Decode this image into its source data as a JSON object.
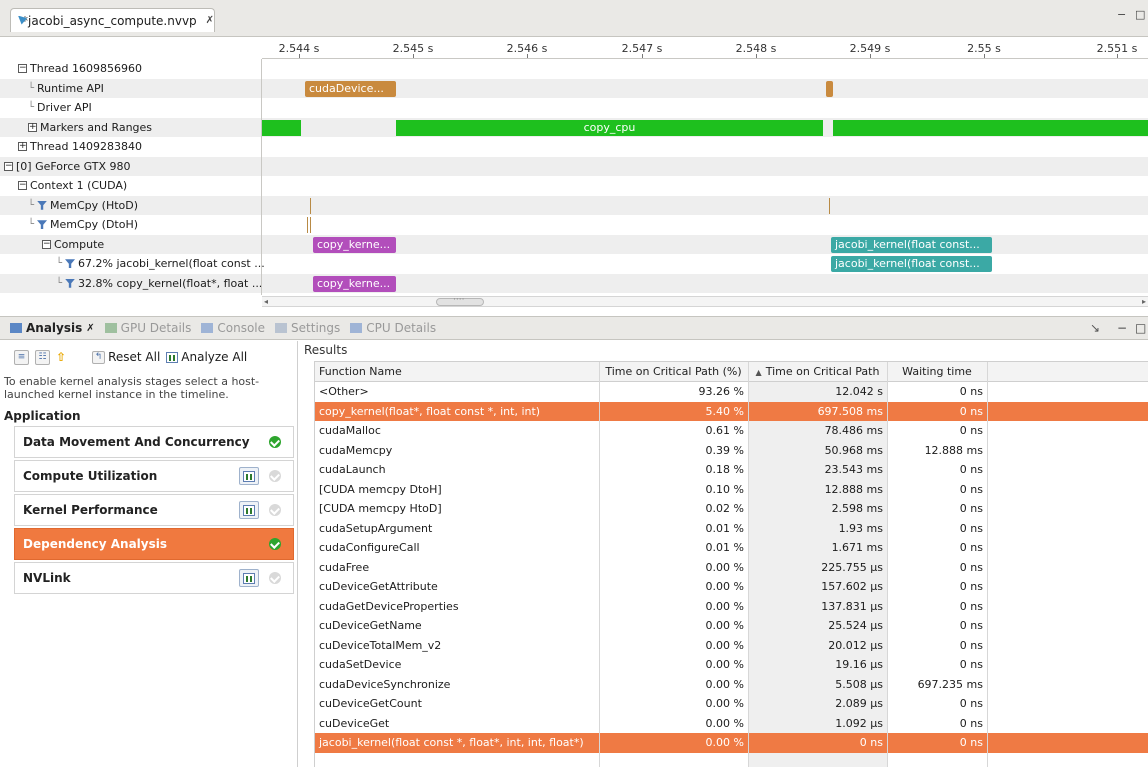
{
  "editor": {
    "tab_title": "*jacobi_async_compute.nvvp",
    "close_glyph": "✗",
    "minimize_glyph": "−",
    "maximize_glyph": "□"
  },
  "timeline": {
    "ticks": [
      "2.544 s",
      "2.545 s",
      "2.546 s",
      "2.547 s",
      "2.548 s",
      "2.549 s",
      "2.55 s",
      "2.551 s"
    ],
    "rows": [
      {
        "label": "Thread 1609856960",
        "expander": "−"
      },
      {
        "label": "Runtime API"
      },
      {
        "label": "Driver API"
      },
      {
        "label": "Markers and Ranges",
        "expander": "+"
      },
      {
        "label": "Thread 1409283840",
        "expander": "+"
      },
      {
        "label": "[0] GeForce GTX 980",
        "expander": "−"
      },
      {
        "label": "Context 1 (CUDA)",
        "expander": "−"
      },
      {
        "label": "MemCpy (HtoD)"
      },
      {
        "label": "MemCpy (DtoH)"
      },
      {
        "label": "Compute",
        "expander": "−"
      },
      {
        "label": "67.2% jacobi_kernel(float const ..."
      },
      {
        "label": "32.8% copy_kernel(float*, float ..."
      }
    ],
    "bars": {
      "runtime_cuda_device": "cudaDevice...",
      "markers_copy_cpu": "copy_cpu",
      "compute_copy_kernel": "copy_kerne...",
      "compute_jacobi_kernel": "jacobi_kernel(float const...",
      "jacobi_row_kernel": "jacobi_kernel(float const...",
      "copy_row_kernel": "copy_kerne..."
    },
    "scroll": {
      "left_arrow": "◂",
      "right_arrow": "▸",
      "thumb_grip": "····"
    }
  },
  "view_tabs": {
    "analysis": "Analysis",
    "analysis_close": "✗",
    "gpu_details": "GPU Details",
    "console": "Console",
    "settings": "Settings",
    "cpu_details": "CPU Details"
  },
  "analysis": {
    "toolbar": {
      "reset_all": "Reset All",
      "analyze_all": "Analyze All",
      "up_arrow": "⇧"
    },
    "hint": "To enable kernel analysis stages select a host-launched kernel instance in the timeline.",
    "section": "Application",
    "stages": [
      {
        "label": "Data Movement And Concurrency"
      },
      {
        "label": "Compute Utilization"
      },
      {
        "label": "Kernel Performance"
      },
      {
        "label": "Dependency Analysis"
      },
      {
        "label": "NVLink"
      }
    ]
  },
  "results": {
    "label": "Results",
    "sort_glyph": "▲",
    "columns": [
      "Function Name",
      "Time on Critical Path (%)",
      "Time on Critical Path",
      "Waiting time"
    ],
    "rows": [
      [
        "<Other>",
        "93.26 %",
        "12.042 s",
        "0 ns"
      ],
      [
        "copy_kernel(float*, float const *, int, int)",
        "5.40 %",
        "697.508 ms",
        "0 ns"
      ],
      [
        "cudaMalloc",
        "0.61 %",
        "78.486 ms",
        "0 ns"
      ],
      [
        "cudaMemcpy",
        "0.39 %",
        "50.968 ms",
        "12.888 ms"
      ],
      [
        "cudaLaunch",
        "0.18 %",
        "23.543 ms",
        "0 ns"
      ],
      [
        "[CUDA memcpy DtoH]",
        "0.10 %",
        "12.888 ms",
        "0 ns"
      ],
      [
        "[CUDA memcpy HtoD]",
        "0.02 %",
        "2.598 ms",
        "0 ns"
      ],
      [
        "cudaSetupArgument",
        "0.01 %",
        "1.93 ms",
        "0 ns"
      ],
      [
        "cudaConfigureCall",
        "0.01 %",
        "1.671 ms",
        "0 ns"
      ],
      [
        "cudaFree",
        "0.00 %",
        "225.755 µs",
        "0 ns"
      ],
      [
        "cuDeviceGetAttribute",
        "0.00 %",
        "157.602 µs",
        "0 ns"
      ],
      [
        "cudaGetDeviceProperties",
        "0.00 %",
        "137.831 µs",
        "0 ns"
      ],
      [
        "cuDeviceGetName",
        "0.00 %",
        "25.524 µs",
        "0 ns"
      ],
      [
        "cuDeviceTotalMem_v2",
        "0.00 %",
        "20.012 µs",
        "0 ns"
      ],
      [
        "cudaSetDevice",
        "0.00 %",
        "19.16 µs",
        "0 ns"
      ],
      [
        "cudaDeviceSynchronize",
        "0.00 %",
        "5.508 µs",
        "697.235 ms"
      ],
      [
        "cuDeviceGetCount",
        "0.00 %",
        "2.089 µs",
        "0 ns"
      ],
      [
        "cuDeviceGet",
        "0.00 %",
        "1.092 µs",
        "0 ns"
      ],
      [
        "jacobi_kernel(float const *, float*, int, int, float*)",
        "0.00 %",
        "0 ns",
        "0 ns"
      ]
    ]
  },
  "colors": {
    "selection": "#ef7a44",
    "runtime_api": "#c98a3e",
    "markers": "#1ec01e",
    "copy_kernel": "#b24ebb",
    "jacobi_kernel": "#3ba9a5",
    "ok_check": "#2ea52e"
  }
}
